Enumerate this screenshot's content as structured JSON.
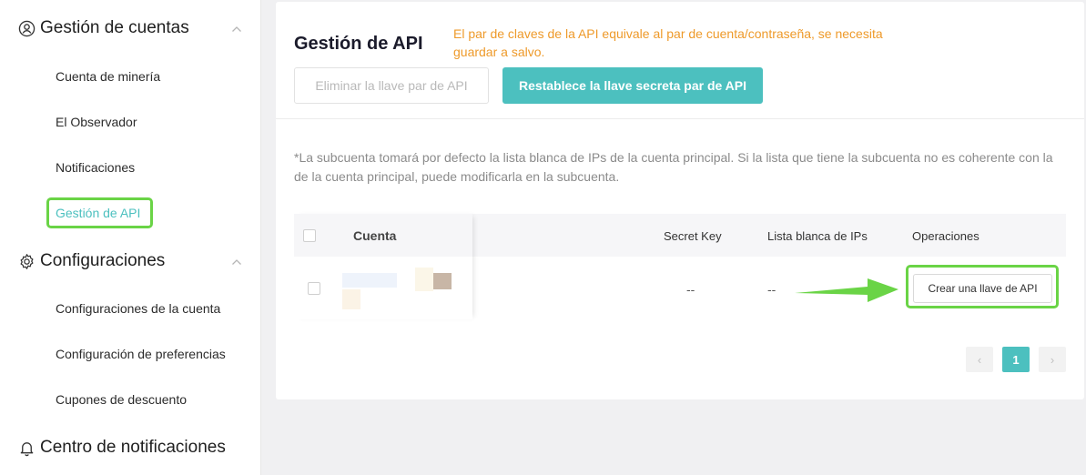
{
  "sidebar": {
    "groups": [
      {
        "title": "Gestión de cuentas",
        "icon": "user-circle-icon"
      },
      {
        "title": "Configuraciones",
        "icon": "gear-icon"
      },
      {
        "title": "Centro de notificaciones",
        "icon": "bell-icon"
      }
    ],
    "accounts_items": [
      "Cuenta de minería",
      "El Observador",
      "Notificaciones",
      "Gestión de API"
    ],
    "config_items": [
      "Configuraciones de la cuenta",
      "Configuración de preferencias",
      "Cupones de descuento"
    ],
    "active_item": "Gestión de API"
  },
  "main": {
    "title": "Gestión de API",
    "notice": "El par de claves de la API equivale al par de cuenta/contraseña, se necesita guardar a salvo.",
    "buttons": {
      "delete": "Eliminar la llave par de API",
      "reset": "Restablece la llave secreta par de API"
    },
    "hint": "*La subcuenta tomará por defecto la lista blanca de IPs de la cuenta principal. Si la lista que tiene la subcuenta no es coherente con la de la cuenta principal, puede modificarla en la subcuenta."
  },
  "table": {
    "columns": {
      "account": "Cuenta",
      "secret_key": "Secret Key",
      "whitelist": "Lista blanca de IPs",
      "operations": "Operaciones"
    },
    "rows": [
      {
        "secret_key": "--",
        "whitelist": "--",
        "action": "Crear una llave de API"
      }
    ]
  },
  "pagination": {
    "current": "1",
    "prev": "‹",
    "next": "›"
  },
  "colors": {
    "accent": "#4cc0bf",
    "warning": "#ee9a2a",
    "highlight": "#6ad446"
  }
}
